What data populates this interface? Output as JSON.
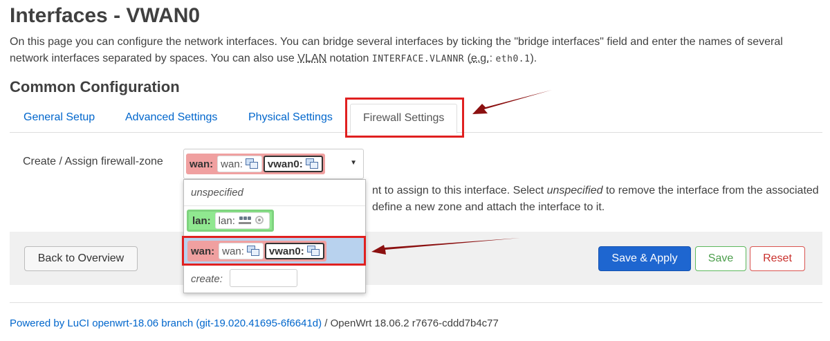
{
  "page": {
    "title": "Interfaces - VWAN0",
    "description": {
      "part1": "On this page you can configure the network interfaces. You can bridge several interfaces by ticking the \"bridge interfaces\" field and enter the names of several network interfaces separated by spaces. You can also use ",
      "vlan": "VLAN",
      "part2": " notation ",
      "code1": "INTERFACE.VLANNR",
      "part3": " (",
      "eg": "e.g.",
      "part4": ": ",
      "code2": "eth0.1",
      "part5": ")."
    }
  },
  "section": {
    "title": "Common Configuration"
  },
  "tabs": [
    {
      "label": "General Setup"
    },
    {
      "label": "Advanced Settings"
    },
    {
      "label": "Physical Settings"
    },
    {
      "label": "Firewall Settings",
      "active": true
    }
  ],
  "firewall": {
    "field_label": "Create / Assign firewall-zone",
    "selected": {
      "zone": "wan:",
      "net1": "wan:",
      "net2": "vwan0:"
    },
    "options": {
      "unspecified": "unspecified",
      "lan": {
        "zone": "lan:",
        "net1": "lan:"
      },
      "wan": {
        "zone": "wan:",
        "net1": "wan:",
        "net2": "vwan0:"
      },
      "create_label": "create:",
      "create_value": ""
    },
    "help": {
      "line1_a": "nt to assign to this interface. Select ",
      "line1_em": "unspecified",
      "line1_b": " to remove the interface from the associated",
      "line2": "define a new zone and attach the interface to it."
    }
  },
  "buttons": {
    "back": "Back to Overview",
    "save_apply": "Save & Apply",
    "save": "Save",
    "reset": "Reset"
  },
  "footer": {
    "link": "Powered by LuCI openwrt-18.06 branch (git-19.020.41695-6f6641d)",
    "text": " / OpenWrt 18.06.2 r7676-cddd7b4c77"
  },
  "colors": {
    "link": "#0066cc",
    "wan_zone": "#f0a0a0",
    "lan_zone": "#90e890",
    "highlight": "#e02020",
    "arrow": "#8b1010",
    "primary_button": "#1e66d0"
  }
}
